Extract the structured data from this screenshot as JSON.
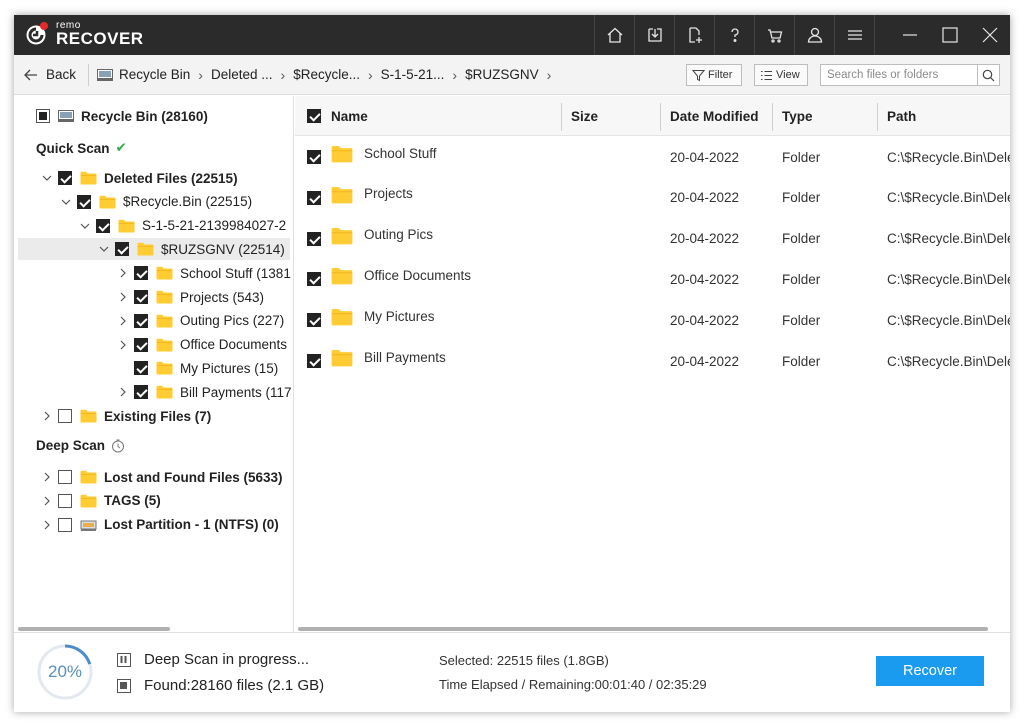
{
  "app": {
    "logo_small": "remo",
    "logo_big": "RECOVER"
  },
  "titlebar": {
    "icons": [
      "home-icon",
      "download-icon",
      "new-file-icon",
      "help-icon",
      "cart-icon",
      "user-icon",
      "menu-icon"
    ],
    "window_controls": [
      "minimize-icon",
      "maximize-icon",
      "close-icon"
    ]
  },
  "nav": {
    "back_label": "Back",
    "breadcrumb": [
      "Recycle Bin",
      "Deleted ...",
      "$Recycle...",
      "S-1-5-21...",
      "$RUZSGNV"
    ],
    "filter_label": "Filter",
    "view_label": "View",
    "search_placeholder": "Search files or folders"
  },
  "tree": {
    "root": "Recycle Bin (28160)",
    "quick_scan_label": "Quick Scan",
    "quick_scan_done_mark": "✔",
    "deep_scan_label": "Deep Scan",
    "quick_items": [
      {
        "label": "Deleted Files (22515)",
        "level": 0,
        "expanded": true,
        "checked": true,
        "bold": true
      },
      {
        "label": "$Recycle.Bin (22515)",
        "level": 1,
        "expanded": true,
        "checked": true,
        "bold": false
      },
      {
        "label": "S-1-5-21-2139984027-2",
        "level": 2,
        "expanded": true,
        "checked": true,
        "bold": false
      },
      {
        "label": "$RUZSGNV (22514)",
        "level": 3,
        "expanded": true,
        "checked": true,
        "bold": false,
        "selected": true
      },
      {
        "label": "School Stuff (1381",
        "level": 4,
        "expanded": false,
        "checked": true,
        "bold": false
      },
      {
        "label": "Projects (543)",
        "level": 4,
        "expanded": false,
        "checked": true,
        "bold": false
      },
      {
        "label": "Outing Pics (227)",
        "level": 4,
        "expanded": false,
        "checked": true,
        "bold": false
      },
      {
        "label": "Office Documents",
        "level": 4,
        "expanded": false,
        "checked": true,
        "bold": false
      },
      {
        "label": "My Pictures (15)",
        "level": 4,
        "expanded": null,
        "checked": true,
        "bold": false
      },
      {
        "label": "Bill Payments (117",
        "level": 4,
        "expanded": false,
        "checked": true,
        "bold": false
      },
      {
        "label": "Existing Files (7)",
        "level": 0,
        "expanded": false,
        "checked": false,
        "bold": true
      }
    ],
    "deep_items": [
      {
        "label": "Lost and Found Files (5633)",
        "icon": "folder"
      },
      {
        "label": "TAGS (5)",
        "icon": "folder"
      },
      {
        "label": "Lost Partition - 1 (NTFS) (0)",
        "icon": "drive"
      }
    ]
  },
  "table": {
    "columns": [
      "Name",
      "Size",
      "Date Modified",
      "Type",
      "Path"
    ],
    "rows": [
      {
        "name": "School Stuff",
        "size": "",
        "date": "20-04-2022",
        "type": "Folder",
        "path": "C:\\$Recycle.Bin\\Dele"
      },
      {
        "name": "Projects",
        "size": "",
        "date": "20-04-2022",
        "type": "Folder",
        "path": "C:\\$Recycle.Bin\\Dele"
      },
      {
        "name": "Outing Pics",
        "size": "",
        "date": "20-04-2022",
        "type": "Folder",
        "path": "C:\\$Recycle.Bin\\Dele"
      },
      {
        "name": "Office Documents",
        "size": "",
        "date": "20-04-2022",
        "type": "Folder",
        "path": "C:\\$Recycle.Bin\\Dele"
      },
      {
        "name": "My Pictures",
        "size": "",
        "date": "20-04-2022",
        "type": "Folder",
        "path": "C:\\$Recycle.Bin\\Dele"
      },
      {
        "name": "Bill Payments",
        "size": "",
        "date": "20-04-2022",
        "type": "Folder",
        "path": "C:\\$Recycle.Bin\\Dele"
      }
    ]
  },
  "status": {
    "progress_percent": 20,
    "progress_label": "20%",
    "scan_status": "Deep Scan in progress...",
    "found_label": "Found:",
    "found_value": "28160 files (2.1 GB)",
    "selected_label": "Selected:",
    "selected_value": "22515 files (1.8GB)",
    "time_label": "Time Elapsed / Remaining:",
    "time_value": "00:01:40 / 02:35:29",
    "recover_label": "Recover"
  },
  "colors": {
    "titlebar": "#2b2b2b",
    "accent": "#1a9bf0",
    "folder": "#ffcc33",
    "progress": "#5a8fb8",
    "check_green": "#2eaa4a"
  }
}
